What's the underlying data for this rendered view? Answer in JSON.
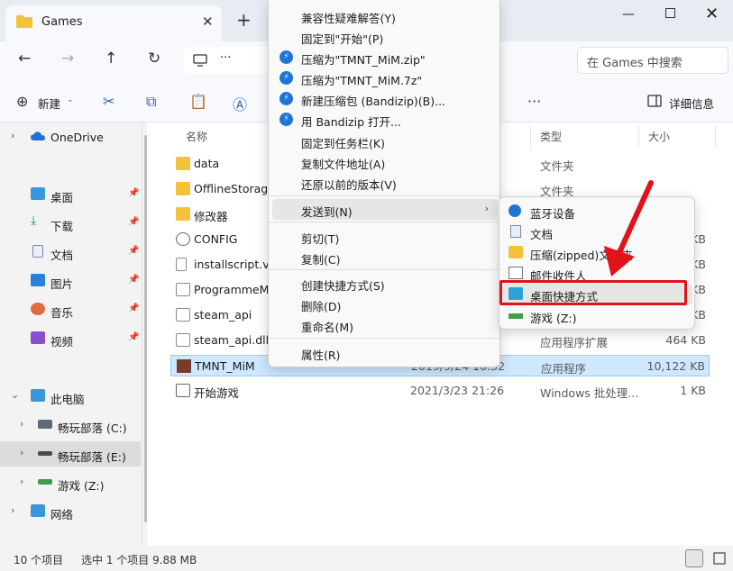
{
  "window": {
    "tab_title": "Games",
    "search_placeholder": "在 Games 中搜索"
  },
  "toolbar": {
    "new_label": "新建",
    "details_label": "详细信息"
  },
  "sidebar": {
    "items": [
      {
        "label": "OneDrive"
      },
      {
        "label": "桌面"
      },
      {
        "label": "下载"
      },
      {
        "label": "文档"
      },
      {
        "label": "图片"
      },
      {
        "label": "音乐"
      },
      {
        "label": "视频"
      },
      {
        "label": "此电脑"
      },
      {
        "label": "畅玩部落 (C:)"
      },
      {
        "label": "畅玩部落 (E:)"
      },
      {
        "label": "游戏 (Z:)"
      },
      {
        "label": "网络"
      }
    ]
  },
  "columns": {
    "name": "名称",
    "type": "类型",
    "size": "大小"
  },
  "files": [
    {
      "name": "data",
      "date": "",
      "type": "文件夹",
      "size": ""
    },
    {
      "name": "OfflineStorage",
      "date": "",
      "type": "文件夹",
      "size": ""
    },
    {
      "name": "修改器",
      "date": "",
      "type": "",
      "size": ""
    },
    {
      "name": "CONFIG",
      "date": "",
      "type": "",
      "size": "KB"
    },
    {
      "name": "installscript.vd",
      "date": "",
      "type": "",
      "size": "KB"
    },
    {
      "name": "ProgrammeM",
      "date": "",
      "type": "",
      "size": "KB"
    },
    {
      "name": "steam_api",
      "date": "",
      "type": "",
      "size": "KB"
    },
    {
      "name": "steam_api.dll",
      "date": "",
      "type": "应用程序扩展",
      "size": "464 KB"
    },
    {
      "name": "TMNT_MiM",
      "date": "2019/9/24 16:32",
      "type": "应用程序",
      "size": "10,122 KB"
    },
    {
      "name": "开始游戏",
      "date": "2021/3/23 21:26",
      "type": "Windows 批处理...",
      "size": "1 KB"
    }
  ],
  "status": {
    "item_count": "10 个项目",
    "selection": "选中 1 个项目  9.88 MB"
  },
  "context_menu": {
    "items": [
      {
        "label": "兼容性疑难解答(Y)"
      },
      {
        "label": "固定到\"开始\"(P)"
      },
      {
        "label": "压缩为\"TMNT_MiM.zip\""
      },
      {
        "label": "压缩为\"TMNT_MiM.7z\""
      },
      {
        "label": "新建压缩包 (Bandizip)(B)..."
      },
      {
        "label": "用 Bandizip 打开..."
      },
      {
        "label": "固定到任务栏(K)"
      },
      {
        "label": "复制文件地址(A)"
      },
      {
        "label": "还原以前的版本(V)"
      },
      {
        "label": "发送到(N)"
      },
      {
        "label": "剪切(T)"
      },
      {
        "label": "复制(C)"
      },
      {
        "label": "创建快捷方式(S)"
      },
      {
        "label": "删除(D)"
      },
      {
        "label": "重命名(M)"
      },
      {
        "label": "属性(R)"
      }
    ]
  },
  "send_to_menu": {
    "items": [
      {
        "label": "蓝牙设备"
      },
      {
        "label": "文档"
      },
      {
        "label": "压缩(zipped)文件夹"
      },
      {
        "label": "邮件收件人"
      },
      {
        "label": "桌面快捷方式"
      },
      {
        "label": "游戏 (Z:)"
      }
    ]
  },
  "colors": {
    "accent": "#1f74d6",
    "selection": "#cde8ff",
    "annotation": "#e0121a"
  }
}
